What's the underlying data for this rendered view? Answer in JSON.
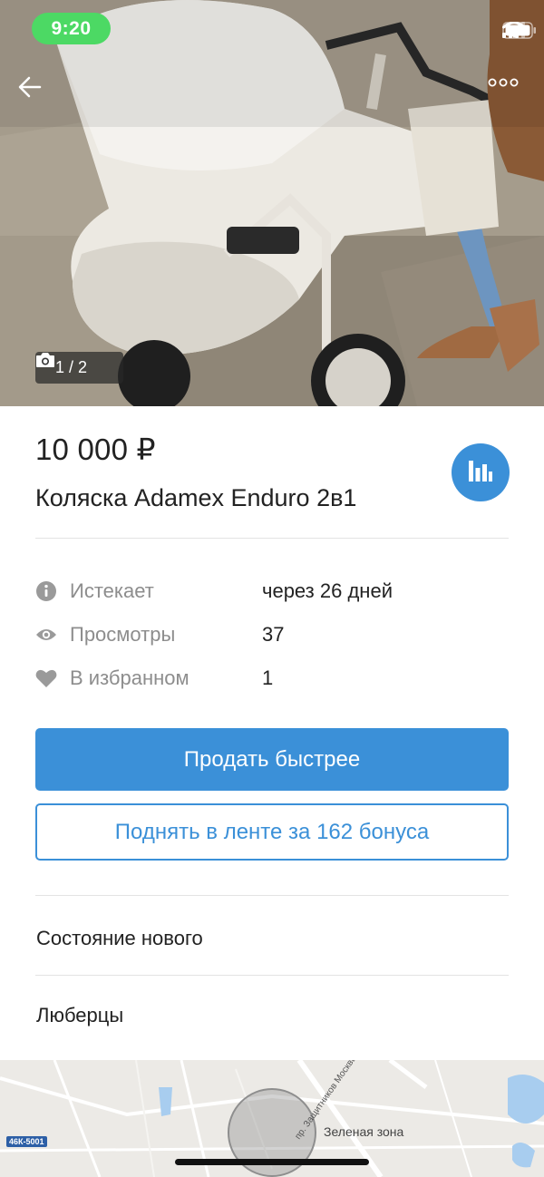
{
  "status_bar": {
    "time": "9:20"
  },
  "gallery": {
    "counter": "1 / 2"
  },
  "listing": {
    "price": "10 000 ₽",
    "title": "Коляска Adamex Enduro 2в1"
  },
  "info": [
    {
      "icon": "info-icon",
      "label": "Истекает",
      "value": "через 26 дней"
    },
    {
      "icon": "eye-icon",
      "label": "Просмотры",
      "value": "37"
    },
    {
      "icon": "heart-icon",
      "label": "В избранном",
      "value": "1"
    }
  ],
  "actions": {
    "sell_faster": "Продать быстрее",
    "boost": "Поднять в ленте за 162 бонуса"
  },
  "details": {
    "condition": "Состояние нового",
    "location": "Люберцы"
  },
  "map": {
    "area_label": "Зеленая зона",
    "street_label": "пр. Защитников Москвы",
    "road_badge": "46К-5001"
  },
  "colors": {
    "accent": "#3b90d8",
    "status_green": "#4cd964"
  }
}
